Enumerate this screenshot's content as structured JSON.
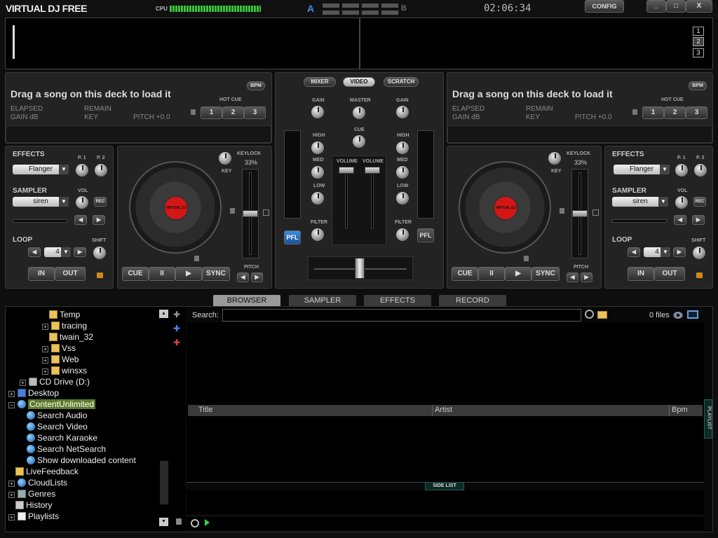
{
  "app": {
    "logo": "VIRTUAL DJ FREE",
    "cpu_label": "CPU",
    "deck_a": "A",
    "deck_b": "B",
    "clock": "02:06:34",
    "config": "CONFIG",
    "win_min": "_",
    "win_max": "□",
    "win_close": "X"
  },
  "wave_selector": [
    "1",
    "2",
    "3"
  ],
  "deck_left": {
    "bpm": "BPM",
    "title": "Drag a song on this deck to load it",
    "elapsed": "ELAPSED",
    "remain": "REMAIN",
    "gain": "GAIN dB",
    "key": "KEY",
    "pitch": "PITCH +0.0",
    "hot_cue": "HOT CUE",
    "hot_cues": [
      "1",
      "2",
      "3"
    ],
    "effects": "EFFECTS",
    "effect_value": "Flanger",
    "p1": "P. 1",
    "p2": "P. 2",
    "sampler": "SAMPLER",
    "sampler_value": "siren",
    "vol": "VOL",
    "rec": "REC",
    "loop": "LOOP",
    "loop_value": "4",
    "shift": "SHIFT",
    "in": "IN",
    "out": "OUT",
    "keylock": "KEYLOCK",
    "keylock_pct": "33%",
    "key_knob": "KEY",
    "pitch_label": "PITCH",
    "platter_label": "VIRTUAL DJ",
    "cue": "CUE",
    "pause": "II",
    "play": "▶",
    "sync": "SYNC"
  },
  "deck_right": {
    "bpm": "BPM",
    "title": "Drag a song on this deck to load it",
    "elapsed": "ELAPSED",
    "remain": "REMAIN",
    "gain": "GAIN dB",
    "key": "KEY",
    "pitch": "PITCH +0.0",
    "hot_cue": "HOT CUE",
    "hot_cues": [
      "1",
      "2",
      "3"
    ],
    "effects": "EFFECTS",
    "effect_value": "Flanger",
    "p1": "P. 1",
    "p2": "P. 2",
    "sampler": "SAMPLER",
    "sampler_value": "siren",
    "vol": "VOL",
    "rec": "REC",
    "loop": "LOOP",
    "loop_value": "4",
    "shift": "SHIFT",
    "in": "IN",
    "out": "OUT",
    "keylock": "KEYLOCK",
    "keylock_pct": "33%",
    "key_knob": "KEY",
    "pitch_label": "PITCH",
    "platter_label": "VIRTUAL DJ",
    "cue": "CUE",
    "pause": "II",
    "play": "▶",
    "sync": "SYNC"
  },
  "mixer": {
    "tabs": [
      "MIXER",
      "VIDEO",
      "SCRATCH"
    ],
    "gain": "GAIN",
    "master": "MASTER",
    "cue": "CUE",
    "high": "HIGH",
    "med": "MED",
    "low": "LOW",
    "volume": "VOLUME",
    "filter": "FILTER",
    "pfl": "PFL"
  },
  "browser_tabs": [
    "BROWSER",
    "SAMPLER",
    "EFFECTS",
    "RECORD"
  ],
  "tree": {
    "items": [
      {
        "label": "Temp",
        "icon": "folder-icon"
      },
      {
        "label": "tracing",
        "icon": "folder-icon"
      },
      {
        "label": "twain_32",
        "icon": "folder-icon"
      },
      {
        "label": "Vss",
        "icon": "folder-icon"
      },
      {
        "label": "Web",
        "icon": "folder-icon"
      },
      {
        "label": "winsxs",
        "icon": "folder-icon"
      },
      {
        "label": "CD Drive (D:)",
        "icon": "cd-drive-icon"
      },
      {
        "label": "Desktop",
        "icon": "desktop-icon"
      },
      {
        "label": "ContentUnlimited",
        "icon": "globe-icon"
      },
      {
        "label": "Search Audio",
        "icon": "globe-icon"
      },
      {
        "label": "Search Video",
        "icon": "globe-icon"
      },
      {
        "label": "Search Karaoke",
        "icon": "globe-icon"
      },
      {
        "label": "Search NetSearch",
        "icon": "globe-icon"
      },
      {
        "label": "Show downloaded content",
        "icon": "globe-icon"
      },
      {
        "label": "LiveFeedback",
        "icon": "folder-icon"
      },
      {
        "label": "CloudLists",
        "icon": "globe-icon"
      },
      {
        "label": "Genres",
        "icon": "genres-icon"
      },
      {
        "label": "History",
        "icon": "history-icon"
      },
      {
        "label": "Playlists",
        "icon": "playlist-icon"
      }
    ]
  },
  "search": {
    "label": "Search:",
    "value": "",
    "file_count": "0 files"
  },
  "columns": [
    "Title",
    "Artist",
    "Bpm"
  ],
  "side_list": "SIDE LIST",
  "playlist_tab": "PLAYLIST"
}
